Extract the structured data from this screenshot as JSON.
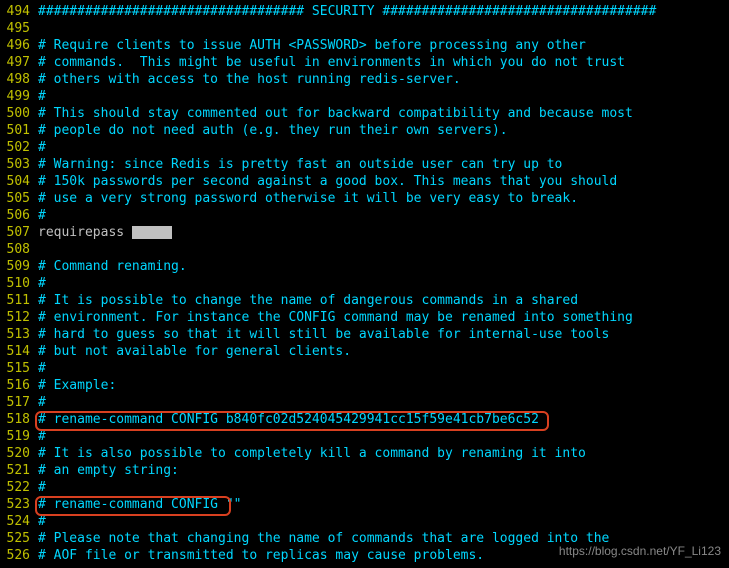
{
  "lines": [
    {
      "n": "494",
      "t": "comment",
      "c": "################################## SECURITY ###################################"
    },
    {
      "n": "495",
      "t": "comment",
      "c": ""
    },
    {
      "n": "496",
      "t": "comment",
      "c": "# Require clients to issue AUTH <PASSWORD> before processing any other"
    },
    {
      "n": "497",
      "t": "comment",
      "c": "# commands.  This might be useful in environments in which you do not trust"
    },
    {
      "n": "498",
      "t": "comment",
      "c": "# others with access to the host running redis-server."
    },
    {
      "n": "499",
      "t": "comment",
      "c": "#"
    },
    {
      "n": "500",
      "t": "comment",
      "c": "# This should stay commented out for backward compatibility and because most"
    },
    {
      "n": "501",
      "t": "comment",
      "c": "# people do not need auth (e.g. they run their own servers)."
    },
    {
      "n": "502",
      "t": "comment",
      "c": "#"
    },
    {
      "n": "503",
      "t": "comment",
      "c": "# Warning: since Redis is pretty fast an outside user can try up to"
    },
    {
      "n": "504",
      "t": "comment",
      "c": "# 150k passwords per second against a good box. This means that you should"
    },
    {
      "n": "505",
      "t": "comment",
      "c": "# use a very strong password otherwise it will be very easy to break."
    },
    {
      "n": "506",
      "t": "comment",
      "c": "#"
    },
    {
      "n": "507",
      "t": "code",
      "c": "requirepass "
    },
    {
      "n": "508",
      "t": "comment",
      "c": ""
    },
    {
      "n": "509",
      "t": "comment",
      "c": "# Command renaming."
    },
    {
      "n": "510",
      "t": "comment",
      "c": "#"
    },
    {
      "n": "511",
      "t": "comment",
      "c": "# It is possible to change the name of dangerous commands in a shared"
    },
    {
      "n": "512",
      "t": "comment",
      "c": "# environment. For instance the CONFIG command may be renamed into something"
    },
    {
      "n": "513",
      "t": "comment",
      "c": "# hard to guess so that it will still be available for internal-use tools"
    },
    {
      "n": "514",
      "t": "comment",
      "c": "# but not available for general clients."
    },
    {
      "n": "515",
      "t": "comment",
      "c": "#"
    },
    {
      "n": "516",
      "t": "comment",
      "c": "# Example:"
    },
    {
      "n": "517",
      "t": "comment",
      "c": "#"
    },
    {
      "n": "518",
      "t": "comment",
      "c": "# rename-command CONFIG b840fc02d524045429941cc15f59e41cb7be6c52"
    },
    {
      "n": "519",
      "t": "comment",
      "c": "#"
    },
    {
      "n": "520",
      "t": "comment",
      "c": "# It is also possible to completely kill a command by renaming it into"
    },
    {
      "n": "521",
      "t": "comment",
      "c": "# an empty string:"
    },
    {
      "n": "522",
      "t": "comment",
      "c": "#"
    },
    {
      "n": "523",
      "t": "comment",
      "c": "# rename-command CONFIG \"\""
    },
    {
      "n": "524",
      "t": "comment",
      "c": "#"
    },
    {
      "n": "525",
      "t": "comment",
      "c": "# Please note that changing the name of commands that are logged into the"
    },
    {
      "n": "526",
      "t": "comment",
      "c": "# AOF file or transmitted to replicas may cause problems."
    }
  ],
  "redacted_line": "507",
  "watermark": "https://blog.csdn.net/YF_Li123"
}
